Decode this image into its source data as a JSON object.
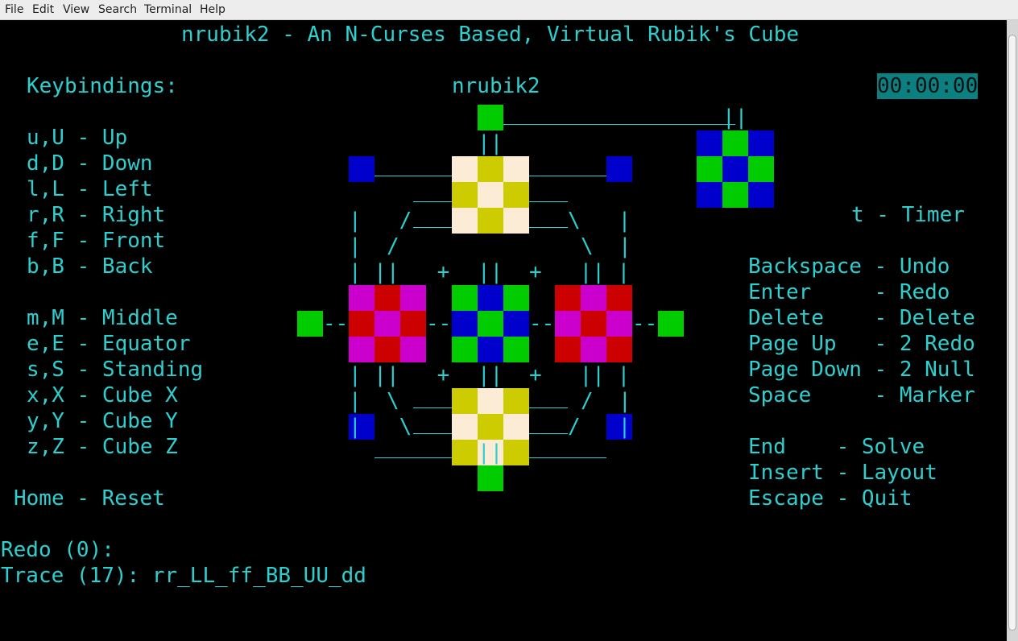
{
  "menu": [
    "File",
    "Edit",
    "View",
    "Search",
    "Terminal",
    "Help"
  ],
  "title": "nrubik2 - An N-Curses Based, Virtual Rubik's Cube",
  "keybindings_heading": "Keybindings:",
  "cube_label": "nrubik2",
  "timer": "00:00:00",
  "left_bindings": [
    "u,U - Up",
    "d,D - Down",
    "l,L - Left",
    "r,R - Right",
    "f,F - Front",
    "b,B - Back",
    "",
    "m,M - Middle",
    "e,E - Equator",
    "s,S - Standing",
    "x,X - Cube X",
    "y,Y - Cube Y",
    "z,Z - Cube Z"
  ],
  "reset_binding": "Home - Reset",
  "timer_binding": "t - Timer",
  "right_bindings": [
    "Backspace - Undo",
    "Enter     - Redo",
    "Delete    - Delete",
    "Page Up   - 2 Redo",
    "Page Down - 2 Null",
    "Space     - Marker"
  ],
  "right_bindings_2": [
    "End    - Solve",
    "Insert - Layout",
    "Escape - Quit"
  ],
  "redo_line": "Redo (0):",
  "trace_line": "Trace (17): rr_LL_ff_BB_UU_dd",
  "ascii_art": [
    {
      "t": "|   /",
      "r": 8,
      "c": 27
    },
    {
      "t": "\\   |",
      "r": 8,
      "c": 44
    },
    {
      "t": "|  /",
      "r": 9,
      "c": 27
    },
    {
      "t": "\\  |",
      "r": 9,
      "c": 45
    },
    {
      "t": "| ||   +",
      "r": 10,
      "c": 27
    },
    {
      "t": "||",
      "r": 10,
      "c": 37
    },
    {
      "t": "+   || |",
      "r": 10,
      "c": 41
    },
    {
      "t": "--",
      "r": 12,
      "c": 25
    },
    {
      "t": "--",
      "r": 12,
      "c": 33
    },
    {
      "t": "--",
      "r": 12,
      "c": 41
    },
    {
      "t": "--",
      "r": 12,
      "c": 49
    },
    {
      "t": "| ||   +",
      "r": 14,
      "c": 27
    },
    {
      "t": "||",
      "r": 14,
      "c": 37
    },
    {
      "t": "+   || |",
      "r": 14,
      "c": 41
    },
    {
      "t": "|  \\",
      "r": 15,
      "c": 27
    },
    {
      "t": "/  |",
      "r": 15,
      "c": 45
    },
    {
      "t": "|   \\",
      "r": 16,
      "c": 27
    },
    {
      "t": "/   |",
      "r": 16,
      "c": 44
    },
    {
      "t": "||",
      "r": 5,
      "c": 37
    },
    {
      "t": "||",
      "r": 17,
      "c": 37
    },
    {
      "t": "||",
      "r": 4,
      "c": 56
    }
  ],
  "colors": {
    "G": "#00cc00",
    "B": "#0000cc",
    "Y": "#cccc00",
    "W": "#fcecd6",
    "M": "#cc00cc",
    "R": "#cc0000",
    "text": "#2ecfcf",
    "timer_bg": "#0c8080"
  },
  "cube": {
    "top_face": [
      "WYW",
      "YWY",
      "WYW"
    ],
    "left_face": [
      "MRM",
      "RMR",
      "MRM"
    ],
    "front_face": [
      "GBG",
      "BGB",
      "GBG"
    ],
    "right_face": [
      "RMR",
      "MRM",
      "RMR"
    ],
    "bottom_face": [
      "YWY",
      "WYW",
      "YWY"
    ],
    "back_face": [
      "BGB",
      "GBG",
      "BGB"
    ],
    "corner_cells": [
      {
        "r": 4,
        "c": 37,
        "k": "G"
      },
      {
        "r": 6,
        "c": 27,
        "k": "B"
      },
      {
        "r": 6,
        "c": 47,
        "k": "B"
      },
      {
        "r": 12,
        "c": 23,
        "k": "G"
      },
      {
        "r": 12,
        "c": 51,
        "k": "G"
      },
      {
        "r": 16,
        "c": 27,
        "k": "B"
      },
      {
        "r": 16,
        "c": 47,
        "k": "B"
      },
      {
        "r": 18,
        "c": 37,
        "k": "G"
      }
    ]
  }
}
